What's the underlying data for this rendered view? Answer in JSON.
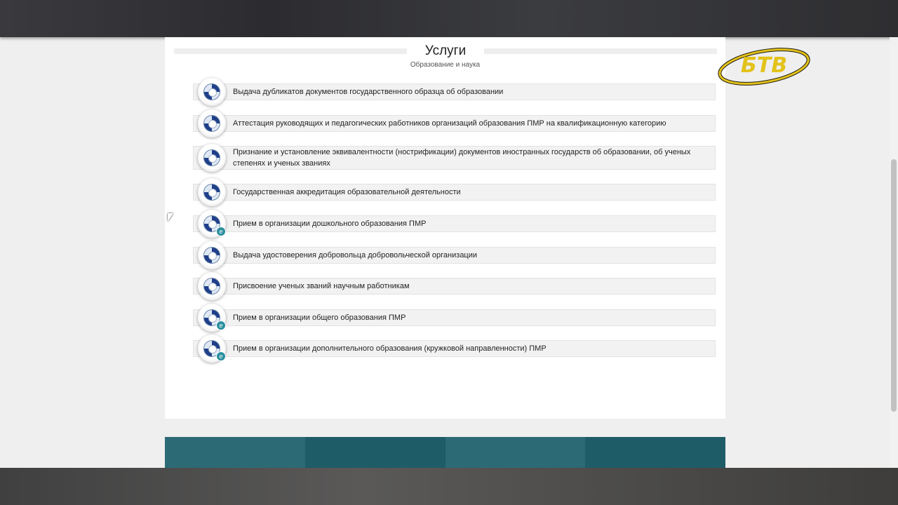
{
  "section": {
    "title": "Услуги",
    "subtitle": "Образование и наука"
  },
  "services": [
    {
      "label": "Выдача дубликатов документов государственного образца об образовании",
      "electronic": false
    },
    {
      "label": "Аттестация руководящих и педагогических работников организаций образования ПМР на квалификационную категорию",
      "electronic": false
    },
    {
      "label": "Признание и установление эквивалентности (нострификации) документов иностранных государств об образовании, об ученых степенях и ученых званиях",
      "electronic": false
    },
    {
      "label": "Государственная аккредитация образовательной деятельности",
      "electronic": false
    },
    {
      "label": "Прием в организации дошкольного образования ПМР",
      "electronic": true
    },
    {
      "label": "Выдача удостоверения добровольца добровольческой организации",
      "electronic": false
    },
    {
      "label": "Присвоение ученых званий научным работникам",
      "electronic": false
    },
    {
      "label": "Прием в организации общего образования ПМР",
      "electronic": true
    },
    {
      "label": "Прием в организации дополнительного образования (кружковой направленности) ПМР",
      "electronic": true
    }
  ],
  "e_badge_glyph": "e",
  "watermark": {
    "text": "БТВ",
    "color": "#e3c21a"
  },
  "icons": {
    "service": "state-emblem-icon",
    "electronic": "e-service-icon"
  },
  "colors": {
    "footer_dark": "#1e5d67",
    "footer_light": "#2c6b75",
    "row_bg": "#f2f2f2"
  }
}
